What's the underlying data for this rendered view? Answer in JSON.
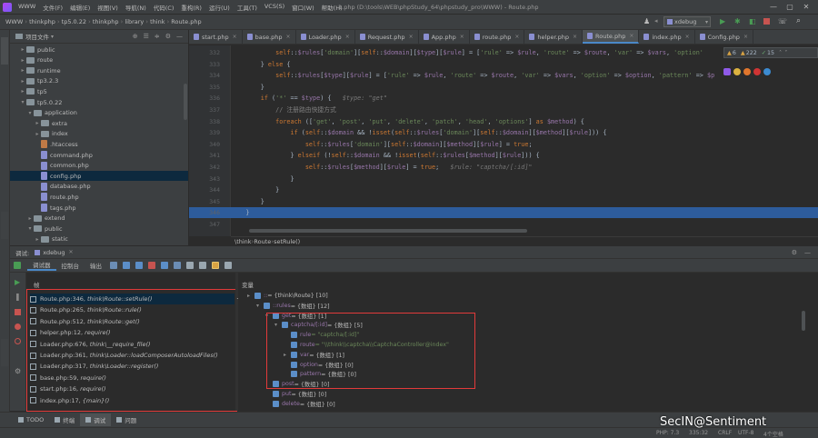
{
  "menu": [
    "WWW",
    "文件(F)",
    "编辑(E)",
    "视图(V)",
    "导航(N)",
    "代码(C)",
    "重构(R)",
    "运行(U)",
    "工具(T)",
    "VCS(S)",
    "窗口(W)",
    "帮助(H)"
  ],
  "window_title": "1.php (D:\\tools\\WEB\\phpStudy_64\\phpstudy_pro\\WWW) - Route.php",
  "breadcrumb": [
    "WWW",
    "thinkphp",
    "tp5.0.22",
    "thinkphp",
    "library",
    "think",
    "Route.php"
  ],
  "run_config": "xdebug",
  "project_panel_title": "项目文件",
  "tree": [
    {
      "label": "public",
      "depth": 3,
      "type": "folder",
      "arrow": "▸"
    },
    {
      "label": "route",
      "depth": 3,
      "type": "folder",
      "arrow": "▸"
    },
    {
      "label": "runtime",
      "depth": 3,
      "type": "folder",
      "arrow": "▸"
    },
    {
      "label": "tp3.2.3",
      "depth": 3,
      "type": "folder",
      "arrow": "▸"
    },
    {
      "label": "tp5",
      "depth": 3,
      "type": "folder",
      "arrow": "▸"
    },
    {
      "label": "tp5.0.22",
      "depth": 3,
      "type": "folder",
      "arrow": "▾"
    },
    {
      "label": "application",
      "depth": 4,
      "type": "folder",
      "arrow": "▾"
    },
    {
      "label": "extra",
      "depth": 5,
      "type": "folder",
      "arrow": "▸"
    },
    {
      "label": "index",
      "depth": 5,
      "type": "folder",
      "arrow": "▸"
    },
    {
      "label": ".htaccess",
      "depth": 5,
      "type": "ht",
      "arrow": ""
    },
    {
      "label": "command.php",
      "depth": 5,
      "type": "php",
      "arrow": ""
    },
    {
      "label": "common.php",
      "depth": 5,
      "type": "php",
      "arrow": ""
    },
    {
      "label": "config.php",
      "depth": 5,
      "type": "php",
      "arrow": "",
      "selected": true
    },
    {
      "label": "database.php",
      "depth": 5,
      "type": "php",
      "arrow": ""
    },
    {
      "label": "route.php",
      "depth": 5,
      "type": "php",
      "arrow": ""
    },
    {
      "label": "tags.php",
      "depth": 5,
      "type": "php",
      "arrow": ""
    },
    {
      "label": "extend",
      "depth": 4,
      "type": "folder",
      "arrow": "▸"
    },
    {
      "label": "public",
      "depth": 4,
      "type": "folder",
      "arrow": "▾"
    },
    {
      "label": "static",
      "depth": 5,
      "type": "folder",
      "arrow": "▸"
    }
  ],
  "tabs": [
    "start.php",
    "base.php",
    "Loader.php",
    "Request.php",
    "App.php",
    "route.php",
    "helper.php",
    "Route.php",
    "index.php",
    "Config.php"
  ],
  "active_tab": "Route.php",
  "inspections": {
    "warnings": "6",
    "weak": "222",
    "typos": "15"
  },
  "line_numbers": [
    "332",
    "333",
    "334",
    "335",
    "336",
    "337",
    "338",
    "339",
    "340",
    "341",
    "342",
    "343",
    "344",
    "345",
    "346",
    "347"
  ],
  "code_lines": [
    [
      {
        "t": "            ",
        "c": ""
      },
      {
        "t": "self",
        "c": "kw"
      },
      {
        "t": "::",
        "c": ""
      },
      {
        "t": "$rules",
        "c": "var"
      },
      {
        "t": "[",
        "c": ""
      },
      {
        "t": "'domain'",
        "c": "str"
      },
      {
        "t": "][",
        "c": ""
      },
      {
        "t": "self",
        "c": "kw"
      },
      {
        "t": "::",
        "c": ""
      },
      {
        "t": "$domain",
        "c": "var"
      },
      {
        "t": "][",
        "c": ""
      },
      {
        "t": "$type",
        "c": "var"
      },
      {
        "t": "][",
        "c": ""
      },
      {
        "t": "$rule",
        "c": "var"
      },
      {
        "t": "] = [",
        "c": ""
      },
      {
        "t": "'rule'",
        "c": "str"
      },
      {
        "t": " => ",
        "c": ""
      },
      {
        "t": "$rule",
        "c": "var"
      },
      {
        "t": ", ",
        "c": ""
      },
      {
        "t": "'route'",
        "c": "str"
      },
      {
        "t": " => ",
        "c": ""
      },
      {
        "t": "$route",
        "c": "var"
      },
      {
        "t": ", ",
        "c": ""
      },
      {
        "t": "'var'",
        "c": "str"
      },
      {
        "t": " => ",
        "c": ""
      },
      {
        "t": "$vars",
        "c": "var"
      },
      {
        "t": ", ",
        "c": ""
      },
      {
        "t": "'option'",
        "c": "str"
      }
    ],
    [
      {
        "t": "        } ",
        "c": ""
      },
      {
        "t": "else",
        "c": "kw"
      },
      {
        "t": " {",
        "c": ""
      }
    ],
    [
      {
        "t": "            ",
        "c": ""
      },
      {
        "t": "self",
        "c": "kw"
      },
      {
        "t": "::",
        "c": ""
      },
      {
        "t": "$rules",
        "c": "var"
      },
      {
        "t": "[",
        "c": ""
      },
      {
        "t": "$type",
        "c": "var"
      },
      {
        "t": "][",
        "c": ""
      },
      {
        "t": "$rule",
        "c": "var"
      },
      {
        "t": "] = [",
        "c": ""
      },
      {
        "t": "'rule'",
        "c": "str"
      },
      {
        "t": " => ",
        "c": ""
      },
      {
        "t": "$rule",
        "c": "var"
      },
      {
        "t": ", ",
        "c": ""
      },
      {
        "t": "'route'",
        "c": "str"
      },
      {
        "t": " => ",
        "c": ""
      },
      {
        "t": "$route",
        "c": "var"
      },
      {
        "t": ", ",
        "c": ""
      },
      {
        "t": "'var'",
        "c": "str"
      },
      {
        "t": " => ",
        "c": ""
      },
      {
        "t": "$vars",
        "c": "var"
      },
      {
        "t": ", ",
        "c": ""
      },
      {
        "t": "'option'",
        "c": "str"
      },
      {
        "t": " => ",
        "c": ""
      },
      {
        "t": "$option",
        "c": "var"
      },
      {
        "t": ", ",
        "c": ""
      },
      {
        "t": "'pattern'",
        "c": "str"
      },
      {
        "t": " => ",
        "c": ""
      },
      {
        "t": "$p",
        "c": "var"
      }
    ],
    [
      {
        "t": "        }",
        "c": ""
      }
    ],
    [
      {
        "t": "        ",
        "c": ""
      },
      {
        "t": "if",
        "c": "kw"
      },
      {
        "t": " (",
        "c": ""
      },
      {
        "t": "'*'",
        "c": "str"
      },
      {
        "t": " == ",
        "c": ""
      },
      {
        "t": "$type",
        "c": "var"
      },
      {
        "t": ") {   ",
        "c": ""
      },
      {
        "t": "$type: \"get\"",
        "c": "hint"
      }
    ],
    [
      {
        "t": "            ",
        "c": ""
      },
      {
        "t": "// 注册路由快捷方式",
        "c": "cm"
      }
    ],
    [
      {
        "t": "            ",
        "c": ""
      },
      {
        "t": "foreach",
        "c": "kw"
      },
      {
        "t": " ([",
        "c": ""
      },
      {
        "t": "'get'",
        "c": "str"
      },
      {
        "t": ", ",
        "c": ""
      },
      {
        "t": "'post'",
        "c": "str"
      },
      {
        "t": ", ",
        "c": ""
      },
      {
        "t": "'put'",
        "c": "str"
      },
      {
        "t": ", ",
        "c": ""
      },
      {
        "t": "'delete'",
        "c": "str"
      },
      {
        "t": ", ",
        "c": ""
      },
      {
        "t": "'patch'",
        "c": "str"
      },
      {
        "t": ", ",
        "c": ""
      },
      {
        "t": "'head'",
        "c": "str"
      },
      {
        "t": ", ",
        "c": ""
      },
      {
        "t": "'options'",
        "c": "str"
      },
      {
        "t": "] ",
        "c": ""
      },
      {
        "t": "as",
        "c": "kw"
      },
      {
        "t": " ",
        "c": ""
      },
      {
        "t": "$method",
        "c": "var"
      },
      {
        "t": ") {",
        "c": ""
      }
    ],
    [
      {
        "t": "                ",
        "c": ""
      },
      {
        "t": "if",
        "c": "kw"
      },
      {
        "t": " (",
        "c": ""
      },
      {
        "t": "self",
        "c": "kw"
      },
      {
        "t": "::",
        "c": ""
      },
      {
        "t": "$domain",
        "c": "var"
      },
      {
        "t": " && !",
        "c": ""
      },
      {
        "t": "isset",
        "c": "kw"
      },
      {
        "t": "(",
        "c": ""
      },
      {
        "t": "self",
        "c": "kw"
      },
      {
        "t": "::",
        "c": ""
      },
      {
        "t": "$rules",
        "c": "var"
      },
      {
        "t": "[",
        "c": ""
      },
      {
        "t": "'domain'",
        "c": "str"
      },
      {
        "t": "][",
        "c": ""
      },
      {
        "t": "self",
        "c": "kw"
      },
      {
        "t": "::",
        "c": ""
      },
      {
        "t": "$domain",
        "c": "var"
      },
      {
        "t": "][",
        "c": ""
      },
      {
        "t": "$method",
        "c": "var"
      },
      {
        "t": "][",
        "c": ""
      },
      {
        "t": "$rule",
        "c": "var"
      },
      {
        "t": "])) {",
        "c": ""
      }
    ],
    [
      {
        "t": "                    ",
        "c": ""
      },
      {
        "t": "self",
        "c": "kw"
      },
      {
        "t": "::",
        "c": ""
      },
      {
        "t": "$rules",
        "c": "var"
      },
      {
        "t": "[",
        "c": ""
      },
      {
        "t": "'domain'",
        "c": "str"
      },
      {
        "t": "][",
        "c": ""
      },
      {
        "t": "self",
        "c": "kw"
      },
      {
        "t": "::",
        "c": ""
      },
      {
        "t": "$domain",
        "c": "var"
      },
      {
        "t": "][",
        "c": ""
      },
      {
        "t": "$method",
        "c": "var"
      },
      {
        "t": "][",
        "c": ""
      },
      {
        "t": "$rule",
        "c": "var"
      },
      {
        "t": "] = ",
        "c": ""
      },
      {
        "t": "true",
        "c": "kw"
      },
      {
        "t": ";",
        "c": ""
      }
    ],
    [
      {
        "t": "                } ",
        "c": ""
      },
      {
        "t": "elseif",
        "c": "kw"
      },
      {
        "t": " (!",
        "c": ""
      },
      {
        "t": "self",
        "c": "kw"
      },
      {
        "t": "::",
        "c": ""
      },
      {
        "t": "$domain",
        "c": "var"
      },
      {
        "t": " && !",
        "c": ""
      },
      {
        "t": "isset",
        "c": "kw"
      },
      {
        "t": "(",
        "c": ""
      },
      {
        "t": "self",
        "c": "kw"
      },
      {
        "t": "::",
        "c": ""
      },
      {
        "t": "$rules",
        "c": "var"
      },
      {
        "t": "[",
        "c": ""
      },
      {
        "t": "$method",
        "c": "var"
      },
      {
        "t": "][",
        "c": ""
      },
      {
        "t": "$rule",
        "c": "var"
      },
      {
        "t": "])) {",
        "c": ""
      }
    ],
    [
      {
        "t": "                    ",
        "c": ""
      },
      {
        "t": "self",
        "c": "kw"
      },
      {
        "t": "::",
        "c": ""
      },
      {
        "t": "$rules",
        "c": "var"
      },
      {
        "t": "[",
        "c": ""
      },
      {
        "t": "$method",
        "c": "var"
      },
      {
        "t": "][",
        "c": ""
      },
      {
        "t": "$rule",
        "c": "var"
      },
      {
        "t": "] = ",
        "c": ""
      },
      {
        "t": "true",
        "c": "kw"
      },
      {
        "t": ";   ",
        "c": ""
      },
      {
        "t": "$rule: \"captcha/[:id]\"",
        "c": "hint"
      }
    ],
    [
      {
        "t": "                }",
        "c": ""
      }
    ],
    [
      {
        "t": "            }",
        "c": ""
      }
    ],
    [
      {
        "t": "        }",
        "c": ""
      }
    ],
    [
      {
        "t": "    }",
        "c": ""
      }
    ],
    [
      {
        "t": "",
        "c": ""
      }
    ]
  ],
  "highlight_line_index": 14,
  "editor_breadcrumb": [
    "\\think",
    "Route",
    "setRule()"
  ],
  "debug": {
    "title": "调试:",
    "config": "xdebug",
    "tabs": [
      "调试器",
      "控制台",
      "输出"
    ],
    "frames_label": "帧",
    "vars_label": "变量",
    "frames": [
      {
        "file": "Route.php:346,",
        "call": "think\\Route::setRule()"
      },
      {
        "file": "Route.php:265,",
        "call": "think\\Route::rule()"
      },
      {
        "file": "Route.php:512,",
        "call": "think\\Route::get()"
      },
      {
        "file": "helper.php:12,",
        "call": "require()"
      },
      {
        "file": "Loader.php:676,",
        "call": "think\\__require_file()"
      },
      {
        "file": "Loader.php:361,",
        "call": "think\\Loader::loadComposerAutoloadFiles()"
      },
      {
        "file": "Loader.php:317,",
        "call": "think\\Loader::register()"
      },
      {
        "file": "base.php:59,",
        "call": "require()"
      },
      {
        "file": "start.php:16,",
        "call": "require()"
      },
      {
        "file": "index.php:17,",
        "call": "{main}()"
      }
    ],
    "vars": [
      {
        "arrow": "▸",
        "name": "::",
        "value": " = {think\\Route} [10]",
        "depth": 0
      },
      {
        "arrow": "▾",
        "name": "::rules",
        "value": " = {数组} [12]",
        "depth": 1
      },
      {
        "arrow": "▾",
        "name": "get",
        "value": " = {数组} [1]",
        "depth": 2
      },
      {
        "arrow": "▾",
        "name": "captcha/[:id]",
        "value": " = {数组} [5]",
        "depth": 3
      },
      {
        "arrow": "",
        "name": "rule",
        "value": " = \"captcha/[:id]\"",
        "depth": 4
      },
      {
        "arrow": "",
        "name": "route",
        "value": " = \"\\\\think\\\\captcha\\\\CaptchaController@index\"",
        "depth": 4
      },
      {
        "arrow": "▸",
        "name": "var",
        "value": " = {数组} [1]",
        "depth": 4
      },
      {
        "arrow": "",
        "name": "option",
        "value": " = {数组} [0]",
        "depth": 4
      },
      {
        "arrow": "",
        "name": "pattern",
        "value": " = {数组} [0]",
        "depth": 4
      },
      {
        "arrow": "",
        "name": "post",
        "value": " = {数组} [0]",
        "depth": 2
      },
      {
        "arrow": "",
        "name": "put",
        "value": " = {数组} [0]",
        "depth": 2
      },
      {
        "arrow": "",
        "name": "delete",
        "value": " = {数组} [0]",
        "depth": 2
      }
    ]
  },
  "bottom_tabs": [
    "TODO",
    "终端",
    "调试",
    "问题"
  ],
  "status": {
    "php": "PHP: 7.3",
    "pos": "335:32",
    "eol": "CRLF",
    "enc": "UTF-8",
    "indent": "4个空格"
  },
  "watermark": "SecIN@Sentiment"
}
